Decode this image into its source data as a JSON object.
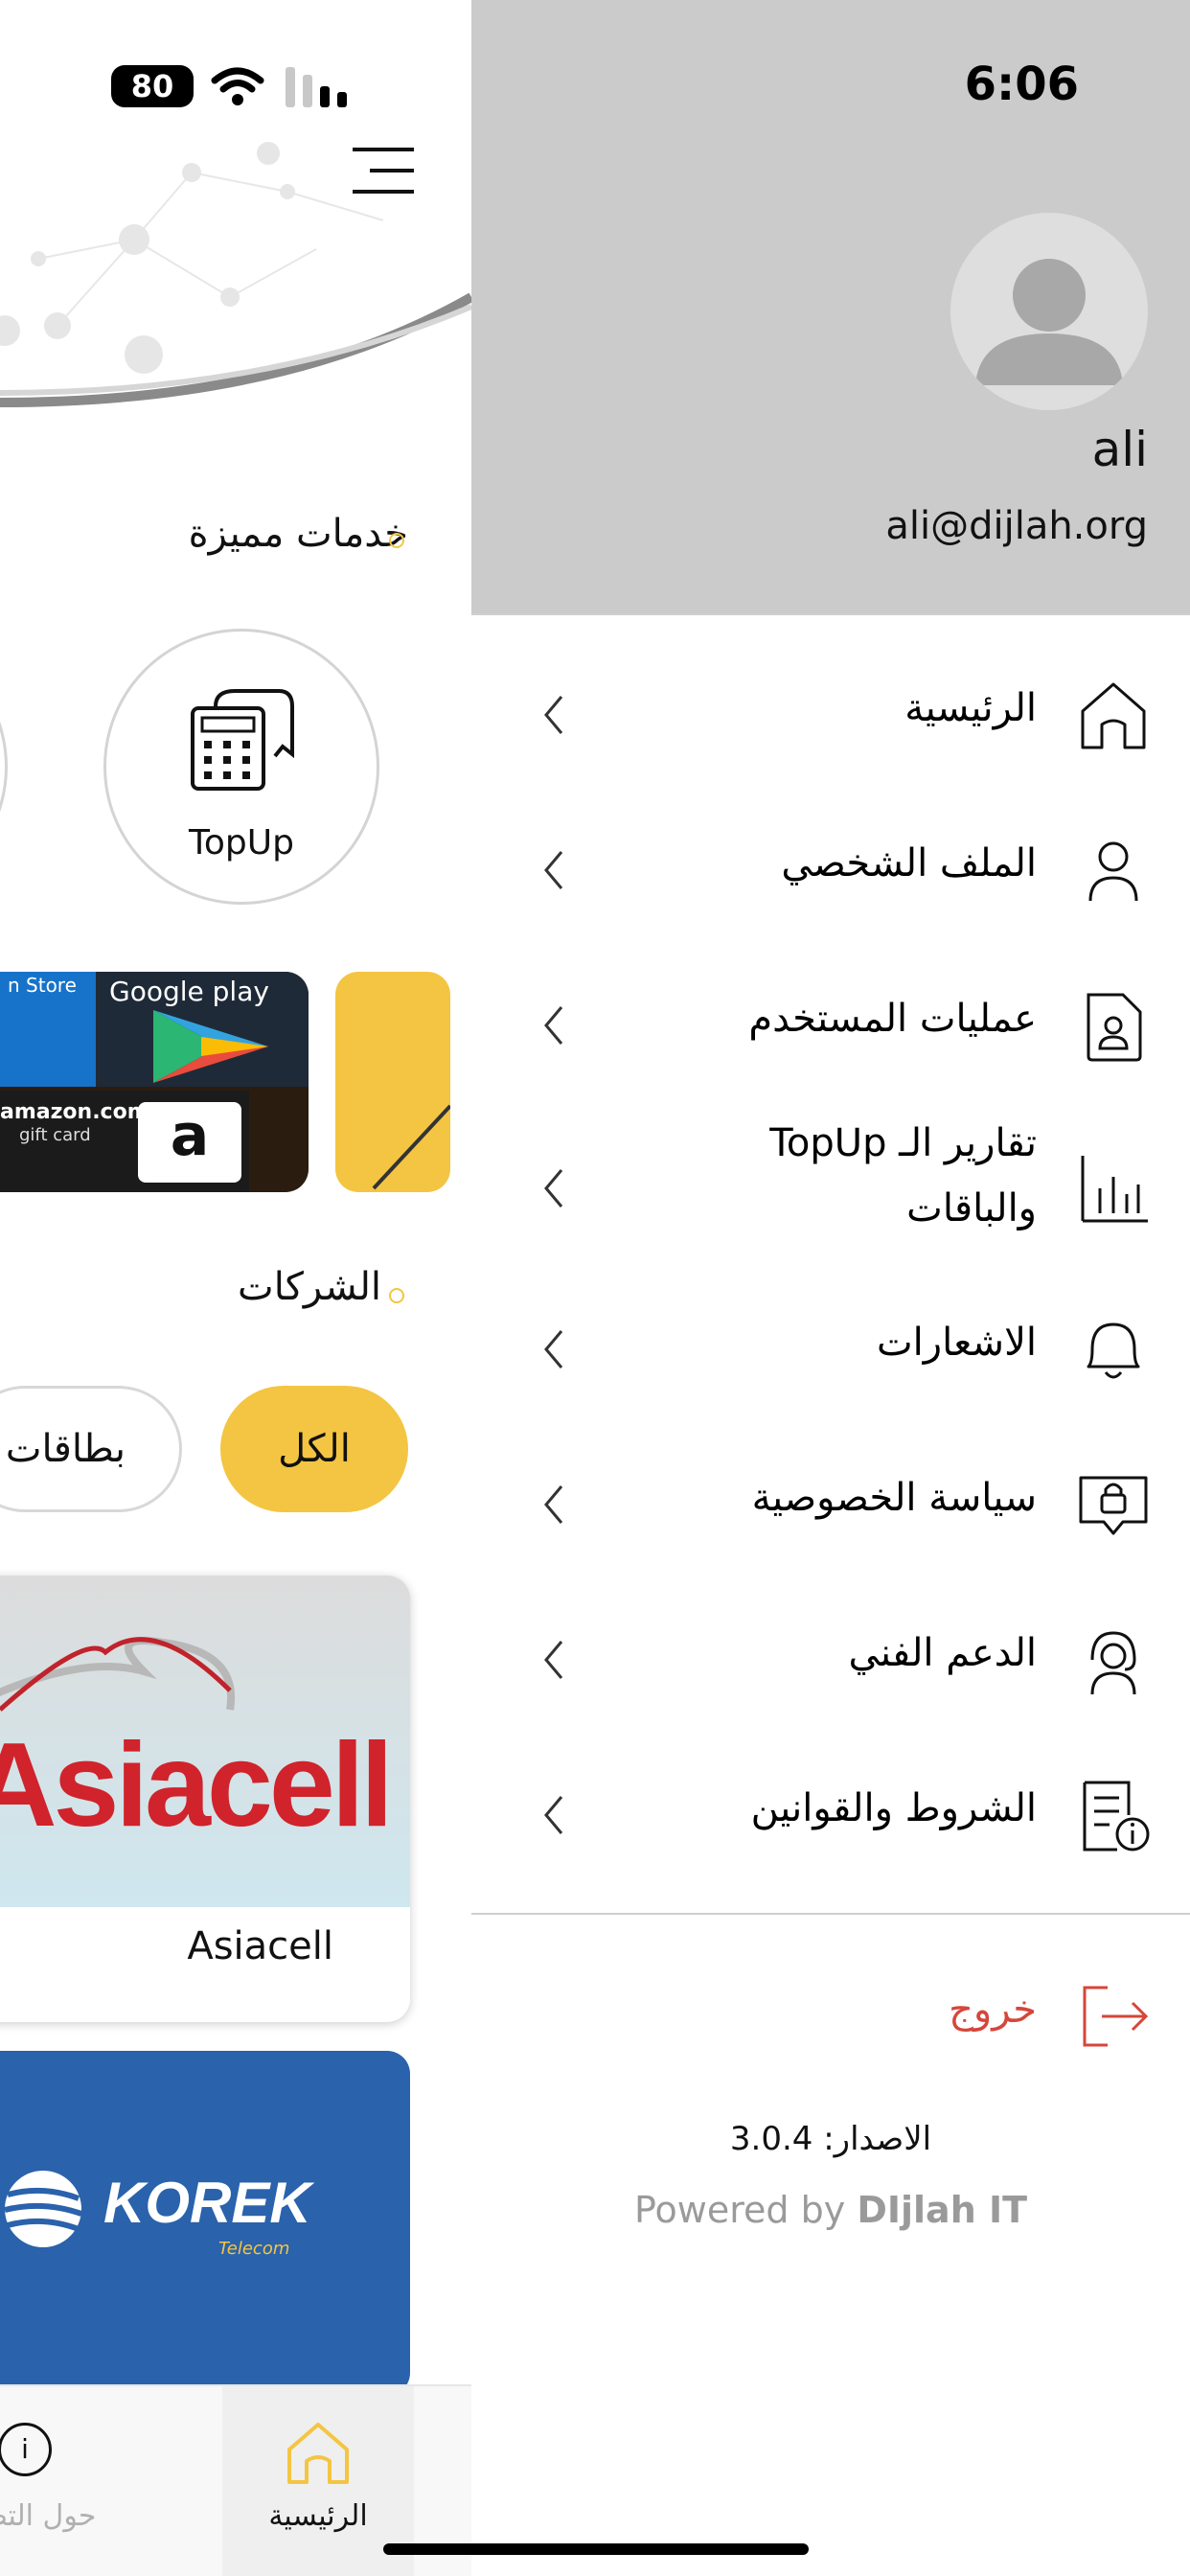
{
  "status_bar": {
    "time": "6:06",
    "battery": "80"
  },
  "drawer": {
    "user": {
      "name": "ali",
      "email": "ali@dijlah.org"
    },
    "menu": [
      {
        "label": "الرئيسية",
        "icon": "home-icon"
      },
      {
        "label": "الملف الشخصي",
        "icon": "user-icon"
      },
      {
        "label": "عمليات المستخدم",
        "icon": "document-user-icon"
      },
      {
        "label_line1": "تقارير الـ TopUp",
        "label_line2": "والباقات",
        "icon": "bar-chart-icon"
      },
      {
        "label": "الاشعارات",
        "icon": "bell-icon"
      },
      {
        "label": "سياسة الخصوصية",
        "icon": "privacy-lock-icon"
      },
      {
        "label": "الدعم الفني",
        "icon": "support-headset-icon"
      },
      {
        "label": "الشروط والقوانين",
        "icon": "terms-info-icon"
      }
    ],
    "logout": {
      "label": "خروج",
      "icon": "logout-icon"
    },
    "version": "الاصدار: 3.0.4",
    "powered_by_prefix": "Powered by",
    "powered_by_brand": "DIjlah IT",
    "colors": {
      "logout": "#d6463a",
      "accent": "#f4c542"
    }
  },
  "main": {
    "featured_title": "خدمات مميزة",
    "featured": [
      {
        "label": "TopUp",
        "icon": "topup-receipt-icon"
      }
    ],
    "banner": {
      "store_text": "n Store",
      "google_play_text": "Google play",
      "amazon_text": "amazon.com",
      "amazon_sub": "gift card",
      "amazon_logo": "a"
    },
    "companies_title": "الشركات",
    "filters": [
      {
        "label": "الكل",
        "selected": true
      },
      {
        "label": "بطاقات",
        "selected": false
      }
    ],
    "companies": [
      {
        "logo_text": "Asiacell",
        "caption": "Asiacell"
      },
      {
        "logo_text": "KOREK",
        "sub": "Telecom"
      }
    ]
  },
  "tabbar": {
    "items": [
      {
        "label": "الرئيسية",
        "icon": "home-icon",
        "active": true
      },
      {
        "label": "حول التط",
        "icon": "info-icon",
        "active": false
      }
    ]
  }
}
